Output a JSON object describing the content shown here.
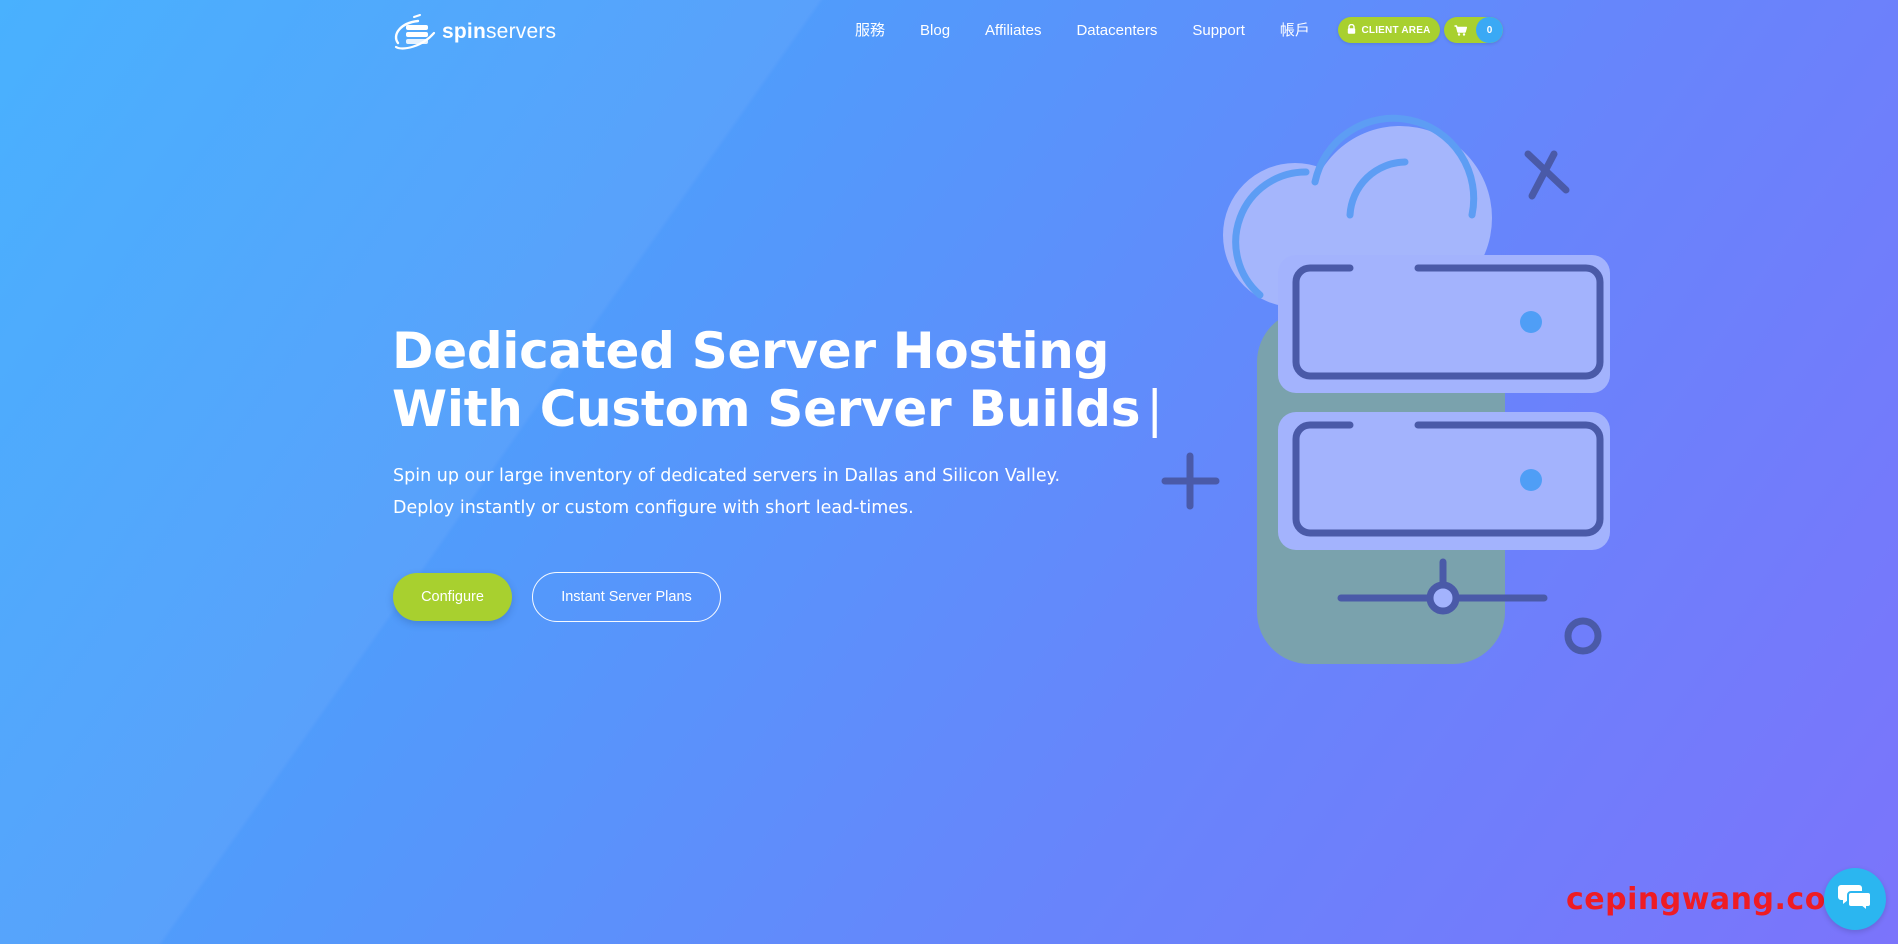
{
  "brand": {
    "name_bold": "spin",
    "name_regular": "servers",
    "logo_icon": "spinning-server-logo-icon"
  },
  "nav": {
    "items": [
      {
        "label": "服務"
      },
      {
        "label": "Blog"
      },
      {
        "label": "Affiliates"
      },
      {
        "label": "Datacenters"
      },
      {
        "label": "Support"
      },
      {
        "label": "帳戶"
      }
    ],
    "client_area_label": "CLIENT AREA",
    "client_area_icon": "lock-icon",
    "cart_icon": "shopping-cart-icon",
    "cart_count": "0"
  },
  "hero": {
    "title_line1": "Dedicated Server Hosting",
    "title_line2": "With Custom Server Builds",
    "cursor": "|",
    "subtitle_line1": "Spin up our large inventory of dedicated servers in Dallas and Silicon Valley.",
    "subtitle_line2": "Deploy instantly or custom configure with short lead-times.",
    "configure_label": "Configure",
    "plans_label": "Instant Server Plans",
    "illustration_icon": "cloud-server-illustration"
  },
  "watermark": {
    "text": "cepingwang.com"
  },
  "chat": {
    "icon": "chat-bubbles-icon"
  },
  "colors": {
    "accent_green": "#a8d02f",
    "accent_blue": "#3aa9f5",
    "bg_start": "#3fadfe",
    "bg_end": "#7b74fb",
    "server_outline": "#4a5aa8",
    "server_fill": "#a3b3fd",
    "watermark_red": "#ee1c24"
  }
}
